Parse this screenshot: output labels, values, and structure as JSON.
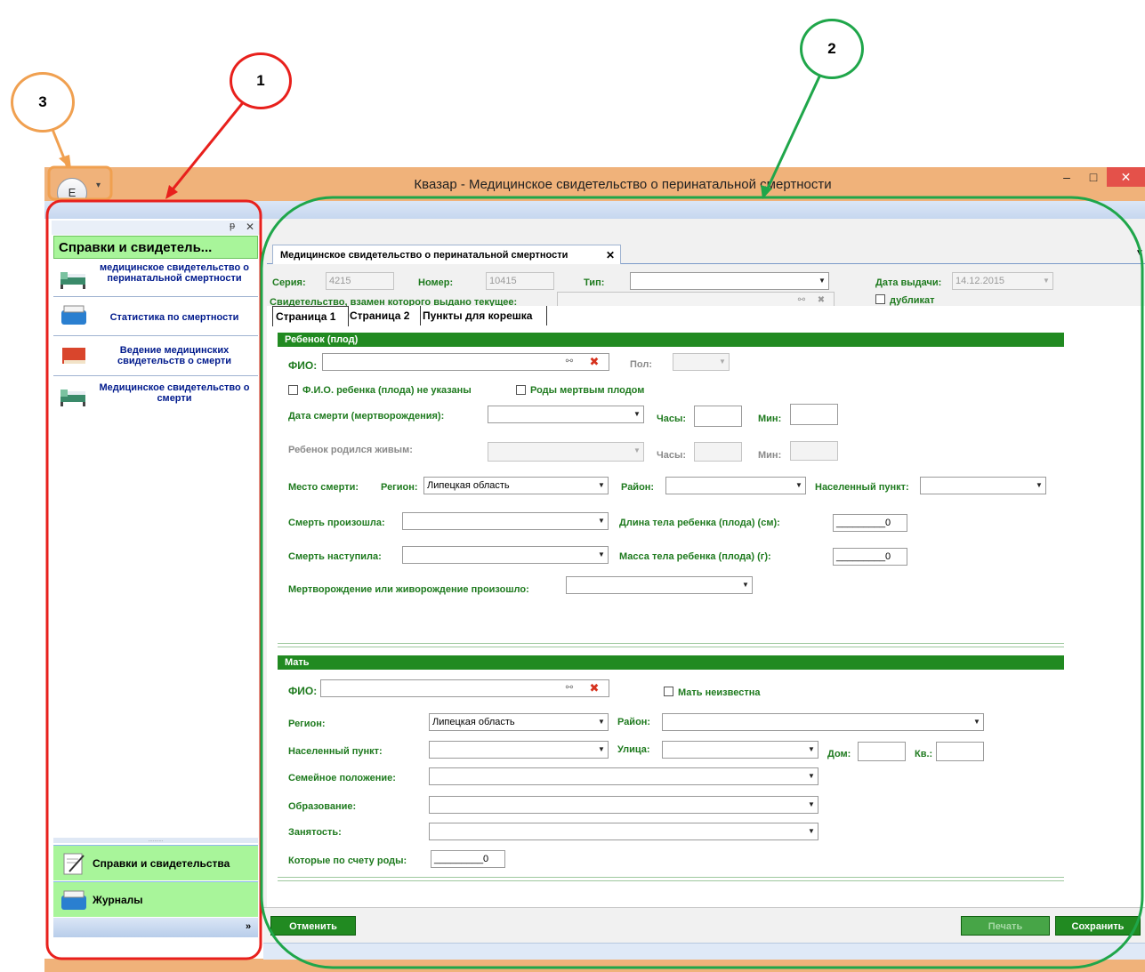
{
  "window": {
    "title": "Квазар - Медицинское свидетельство о перинатальной смертности",
    "app_button": "E",
    "qat_arrow": "▾",
    "minimize": "–",
    "maximize": "□",
    "close": "✕"
  },
  "annotations": {
    "callout_1": "1",
    "callout_2": "2",
    "callout_3": "3",
    "colors": {
      "callout_1": "#e8201c",
      "callout_2": "#1fa64a",
      "callout_3": "#f0a050"
    }
  },
  "left_panel": {
    "pin": "ᵽ",
    "close": "✕",
    "title": "Справки и свидетель...",
    "items": [
      {
        "label": "медицинское свидетельство о перинатальной смертности",
        "icon": "hospital-bed-icon"
      },
      {
        "label": "Статистика по смертности",
        "icon": "folder-box-icon"
      },
      {
        "label": "Ведение медицинских свидетельств о смерти",
        "icon": "red-book-icon"
      },
      {
        "label": "Медицинское свидетельство о смерти",
        "icon": "hospital-bed-icon"
      }
    ],
    "splitter": "..........",
    "bottom_items": [
      {
        "label": "Справки и свидетельства",
        "icon": "document-pen-icon"
      },
      {
        "label": "Журналы",
        "icon": "folder-box-icon"
      }
    ],
    "more": "»"
  },
  "document_tab": {
    "label": "Медицинское свидетельство о перинатальной смертности",
    "close": "✕"
  },
  "header": {
    "series_label": "Серия:",
    "series_value": "4215",
    "number_label": "Номер:",
    "number_value": "10415",
    "type_label": "Тип:",
    "type_value": "",
    "issue_date_label": "Дата выдачи:",
    "issue_date_value": "14.12.2015",
    "replaced_label": "Свидетельство, взамен которого выдано текущее:",
    "replaced_value": "",
    "duplicate_label": "дубликат"
  },
  "page_tabs": [
    "Страница 1",
    "Страница 2",
    "Пункты для корешка"
  ],
  "child": {
    "section_title": "Ребенок (плод)",
    "fio_label": "ФИО:",
    "fio_value": "",
    "sex_label": "Пол:",
    "sex_value": "",
    "no_name_label": "Ф.И.О. ребенка (плода) не указаны",
    "stillbirth_label": "Роды мертвым плодом",
    "death_date_label": "Дата смерти (мертворождения):",
    "death_date_value": "",
    "hours_label": "Часы:",
    "hours_value": "",
    "min_label": "Мин:",
    "min_value": "",
    "born_alive_label": "Ребенок родился живым:",
    "born_alive_value": "",
    "born_hours_label": "Часы:",
    "born_min_label": "Мин:",
    "death_place_label": "Место смерти:",
    "region_label": "Регион:",
    "region_value": "Липецкая область",
    "district_label": "Район:",
    "district_value": "",
    "locality_label": "Населенный пункт:",
    "locality_value": "",
    "death_occurred_label": "Смерть произошла:",
    "death_occurred_value": "",
    "body_length_label": "Длина тела ребенка (плода) (см):",
    "body_length_value": "_________0",
    "death_came_label": "Смерть наступила:",
    "death_came_value": "",
    "body_mass_label": "Масса тела ребенка (плода) (г):",
    "body_mass_value": "_________0",
    "birth_place_label": "Мертворождение или живорождение произошло:",
    "birth_place_value": ""
  },
  "mother": {
    "section_title": "Мать",
    "fio_label": "ФИО:",
    "fio_value": "",
    "unknown_label": "Мать неизвестна",
    "region_label": "Регион:",
    "region_value": "Липецкая область",
    "district_label": "Район:",
    "district_value": "",
    "locality_label": "Населенный пункт:",
    "locality_value": "",
    "street_label": "Улица:",
    "street_value": "",
    "house_label": "Дом:",
    "house_value": "",
    "apt_label": "Кв.:",
    "apt_value": "",
    "marital_label": "Семейное положение:",
    "marital_value": "",
    "education_label": "Образование:",
    "education_value": "",
    "employment_label": "Занятость:",
    "employment_value": "",
    "births_label": "Которые по счету роды:",
    "births_value": "_________0"
  },
  "buttons": {
    "cancel": "Отменить",
    "print": "Печать",
    "save": "Сохранить"
  }
}
